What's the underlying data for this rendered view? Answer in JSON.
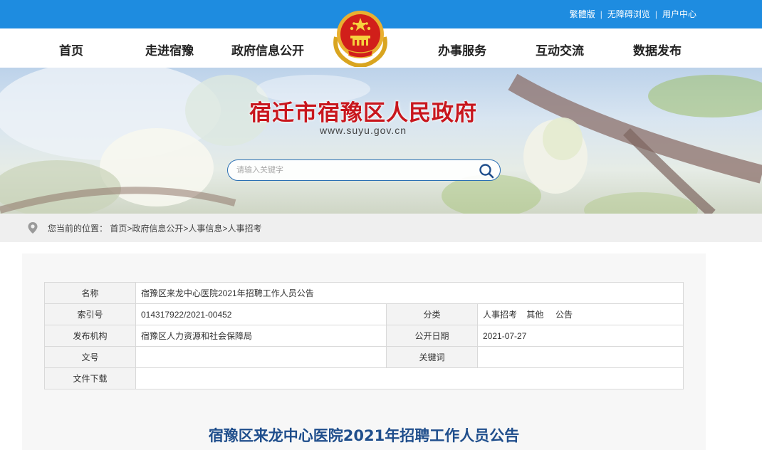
{
  "top_links": [
    "繁體版",
    "无障碍浏览",
    "用户中心"
  ],
  "nav": [
    "首页",
    "走进宿豫",
    "政府信息公开",
    "办事服务",
    "互动交流",
    "数据发布"
  ],
  "banner": {
    "title": "宿迁市宿豫区人民政府",
    "url": "www.suyu.gov.cn"
  },
  "search": {
    "placeholder": "请输入关键字"
  },
  "breadcrumb": {
    "prefix": "您当前的位置：",
    "items": [
      "首页",
      "政府信息公开",
      "人事信息",
      "人事招考"
    ],
    "separator": ">"
  },
  "meta": {
    "name_label": "名称",
    "name_value": "宿豫区来龙中心医院2021年招聘工作人员公告",
    "index_label": "索引号",
    "index_value": "014317922/2021-00452",
    "category_label": "分类",
    "category_value": "人事招考    其他     公告",
    "publisher_label": "发布机构",
    "publisher_value": "宿豫区人力资源和社会保障局",
    "date_label": "公开日期",
    "date_value": "2021-07-27",
    "docno_label": "文号",
    "docno_value": "",
    "keyword_label": "关键词",
    "keyword_value": "",
    "download_label": "文件下载",
    "download_value": ""
  },
  "doc_title": "宿豫区来龙中心医院2021年招聘工作人员公告",
  "colors": {
    "topbar": "#1e8ce0",
    "banner_title": "#c8161d",
    "doc_title": "#1f4e8c"
  },
  "icons": [
    "national-emblem-icon",
    "search-icon",
    "location-pin-icon"
  ]
}
